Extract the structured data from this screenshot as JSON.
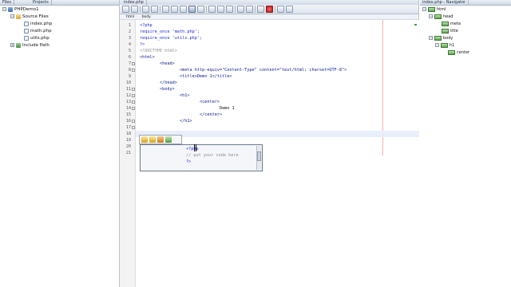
{
  "left_panel": {
    "tabs": [
      "Files",
      "Projects"
    ],
    "tree": [
      {
        "label": "PHPDemo1",
        "icon": "project-icon",
        "level": 0,
        "expanded": true
      },
      {
        "label": "Source Files",
        "icon": "folder-icon",
        "level": 1,
        "expanded": true
      },
      {
        "label": "index.php",
        "icon": "php-file-icon",
        "level": 2
      },
      {
        "label": "math.php",
        "icon": "php-file-icon",
        "level": 2
      },
      {
        "label": "utils.php",
        "icon": "php-file-icon",
        "level": 2
      },
      {
        "label": "Include Path",
        "icon": "library-icon",
        "level": 1,
        "expanded": false
      }
    ]
  },
  "editor": {
    "tabs": [
      "index.php"
    ],
    "breadcrumb": [
      "html",
      "body"
    ],
    "lines": [
      {
        "n": "1",
        "text": "<?php"
      },
      {
        "n": "2",
        "text": "require_once 'math.php';"
      },
      {
        "n": "3",
        "text": "require_once 'utils.php';"
      },
      {
        "n": "4",
        "text": "?>"
      },
      {
        "n": "5",
        "text": "<!DOCTYPE html>"
      },
      {
        "n": "6",
        "text": "<html>"
      },
      {
        "n": "7",
        "text": "        <head>"
      },
      {
        "n": "8",
        "text": "                <meta http-equiv=\"Content-Type\" content=\"text/html; charset=UTF-8\">"
      },
      {
        "n": "9",
        "text": "                <title>Demo 1</title>"
      },
      {
        "n": "10",
        "text": "        </head>"
      },
      {
        "n": "11",
        "text": "        <body>"
      },
      {
        "n": "12",
        "text": "                <h1>"
      },
      {
        "n": "13",
        "text": "                        <center>"
      },
      {
        "n": "14",
        "text": "                                Demo 1"
      },
      {
        "n": "15",
        "text": "                        </center>"
      },
      {
        "n": "16",
        "text": "                </h1>"
      },
      {
        "n": "17",
        "text": ""
      },
      {
        "n": "18",
        "text": ""
      },
      {
        "n": "19",
        "text": "        >"
      },
      {
        "n": "20",
        "text": ""
      },
      {
        "n": "21",
        "text": ""
      }
    ]
  },
  "completion": {
    "lines": [
      "<?php",
      "// put your code here",
      "?>"
    ]
  },
  "navigator": {
    "tabs": [
      "index.php - Navigator"
    ],
    "tree": [
      {
        "label": "html",
        "level": 0
      },
      {
        "label": "head",
        "level": 1
      },
      {
        "label": "meta",
        "level": 2
      },
      {
        "label": "title",
        "level": 2
      },
      {
        "label": "body",
        "level": 1
      },
      {
        "label": "h1",
        "level": 2
      },
      {
        "label": "center",
        "level": 3
      }
    ]
  },
  "colors": {
    "keyword": "#1d2bd1",
    "string": "#b5582f",
    "comment": "#8a8a8a",
    "current_line": "#e9effa"
  }
}
